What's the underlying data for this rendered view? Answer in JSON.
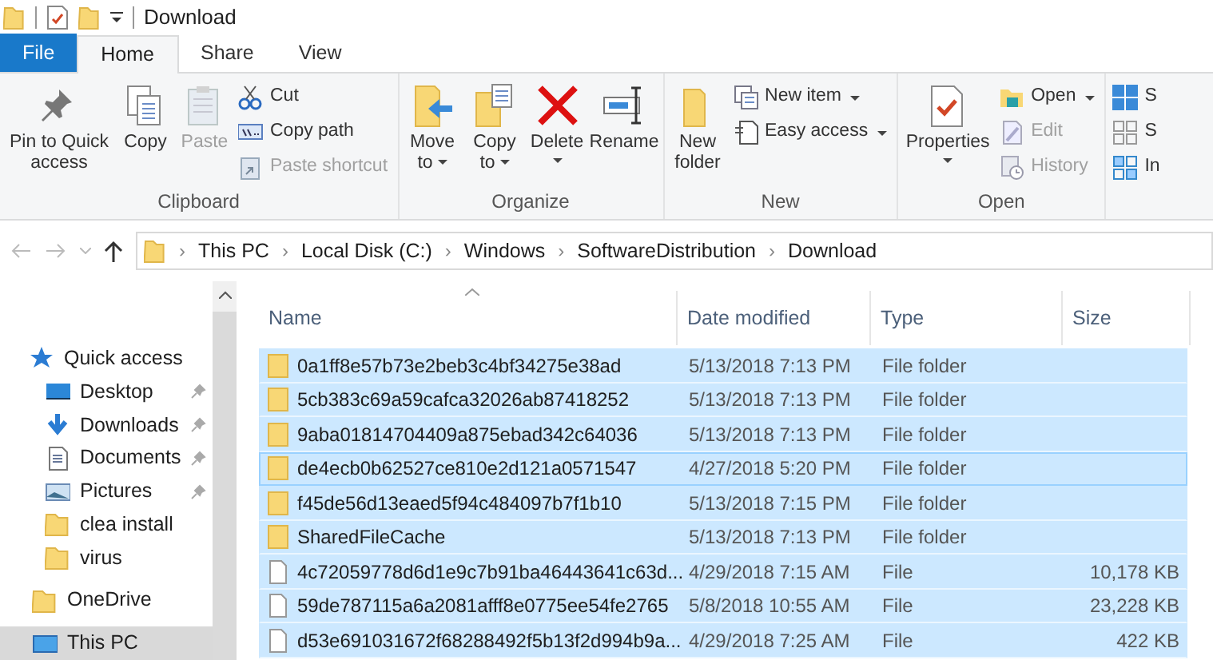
{
  "window": {
    "title": "Download"
  },
  "tabs": [
    {
      "label": "File",
      "kind": "file",
      "selected": false
    },
    {
      "label": "Home",
      "kind": "tab",
      "selected": true
    },
    {
      "label": "Share",
      "kind": "tab",
      "selected": false
    },
    {
      "label": "View",
      "kind": "tab",
      "selected": false
    }
  ],
  "ribbon_groups": [
    {
      "name": "Clipboard",
      "large": [
        {
          "label": "Pin to Quick access",
          "disabled": false,
          "dropdown": false
        },
        {
          "label": "Copy",
          "disabled": false,
          "dropdown": false
        },
        {
          "label": "Paste",
          "disabled": true,
          "dropdown": false
        }
      ],
      "small": [
        {
          "label": "Cut",
          "disabled": false,
          "dropdown": false
        },
        {
          "label": "Copy path",
          "disabled": false,
          "dropdown": false
        },
        {
          "label": "Paste shortcut",
          "disabled": true,
          "dropdown": false
        }
      ]
    },
    {
      "name": "Organize",
      "large": [
        {
          "label": "Move to",
          "disabled": false,
          "dropdown": true
        },
        {
          "label": "Copy to",
          "disabled": false,
          "dropdown": true
        },
        {
          "label": "Delete",
          "disabled": false,
          "dropdown": true
        },
        {
          "label": "Rename",
          "disabled": false,
          "dropdown": false
        }
      ]
    },
    {
      "name": "New",
      "large": [
        {
          "label": "New folder",
          "disabled": false,
          "dropdown": false
        }
      ],
      "small": [
        {
          "label": "New item",
          "disabled": false,
          "dropdown": true
        },
        {
          "label": "Easy access",
          "disabled": false,
          "dropdown": true
        }
      ]
    },
    {
      "name": "Open",
      "large": [
        {
          "label": "Properties",
          "disabled": false,
          "dropdown": true
        }
      ],
      "small": [
        {
          "label": "Open",
          "disabled": false,
          "dropdown": true
        },
        {
          "label": "Edit",
          "disabled": true,
          "dropdown": false
        },
        {
          "label": "History",
          "disabled": true,
          "dropdown": false
        }
      ]
    },
    {
      "small": [
        {
          "label": "S",
          "disabled": false,
          "dropdown": false
        },
        {
          "label": "S",
          "disabled": false,
          "dropdown": false
        },
        {
          "label": "In",
          "disabled": false,
          "dropdown": false
        }
      ]
    }
  ],
  "address": {
    "crumbs": [
      "This PC",
      "Local Disk (C:)",
      "Windows",
      "SoftwareDistribution",
      "Download"
    ],
    "separator": "›"
  },
  "nav": [
    {
      "label": "Quick access",
      "kind": "quick",
      "pinned": false,
      "selected": false
    },
    {
      "label": "Desktop",
      "kind": "desktop",
      "pinned": true,
      "selected": false
    },
    {
      "label": "Downloads",
      "kind": "downloads",
      "pinned": true,
      "selected": false
    },
    {
      "label": "Documents",
      "kind": "documents",
      "pinned": true,
      "selected": false
    },
    {
      "label": "Pictures",
      "kind": "pictures",
      "pinned": true,
      "selected": false
    },
    {
      "label": "clea install",
      "kind": "folder",
      "pinned": false,
      "selected": false
    },
    {
      "label": "virus",
      "kind": "folder",
      "pinned": false,
      "selected": false
    },
    {
      "label": "OneDrive",
      "kind": "onedrive",
      "pinned": false,
      "selected": false
    },
    {
      "label": "This PC",
      "kind": "pc",
      "pinned": false,
      "selected": true
    }
  ],
  "table": {
    "columns": [
      "Name",
      "Date modified",
      "Type",
      "Size"
    ],
    "rows": [
      {
        "kind": "folder",
        "name": "0a1ff8e57b73e2beb3c4bf34275e38ad",
        "date": "5/13/2018 7:13 PM",
        "type": "File folder",
        "selected": true,
        "focused": false
      },
      {
        "kind": "folder",
        "name": "5cb383c69a59cafca32026ab87418252",
        "date": "5/13/2018 7:13 PM",
        "type": "File folder",
        "selected": true,
        "focused": false
      },
      {
        "kind": "folder",
        "name": "9aba01814704409a875ebad342c64036",
        "date": "5/13/2018 7:13 PM",
        "type": "File folder",
        "selected": true,
        "focused": false
      },
      {
        "kind": "folder",
        "name": "de4ecb0b62527ce810e2d121a0571547",
        "date": "4/27/2018 5:20 PM",
        "type": "File folder",
        "selected": true,
        "focused": true
      },
      {
        "kind": "folder",
        "name": "f45de56d13eaed5f94c484097b7f1b10",
        "date": "5/13/2018 7:15 PM",
        "type": "File folder",
        "selected": true,
        "focused": false
      },
      {
        "kind": "folder",
        "name": "SharedFileCache",
        "date": "5/13/2018 7:13 PM",
        "type": "File folder",
        "selected": true,
        "focused": false
      },
      {
        "kind": "file",
        "name": "4c72059778d6d1e9c7b91ba46443641c63d...",
        "date": "4/29/2018 7:15 AM",
        "type": "File",
        "size": "10,178 KB",
        "selected": true,
        "focused": false
      },
      {
        "kind": "file",
        "name": "59de787115a6a2081afff8e0775ee54fe2765",
        "date": "5/8/2018 10:55 AM",
        "type": "File",
        "size": "23,228 KB",
        "selected": true,
        "focused": false
      },
      {
        "kind": "file",
        "name": "d53e691031672f68288492f5b13f2d994b9a...",
        "date": "4/29/2018 7:25 AM",
        "type": "File",
        "size": "422 KB",
        "selected": true,
        "focused": false
      }
    ]
  }
}
